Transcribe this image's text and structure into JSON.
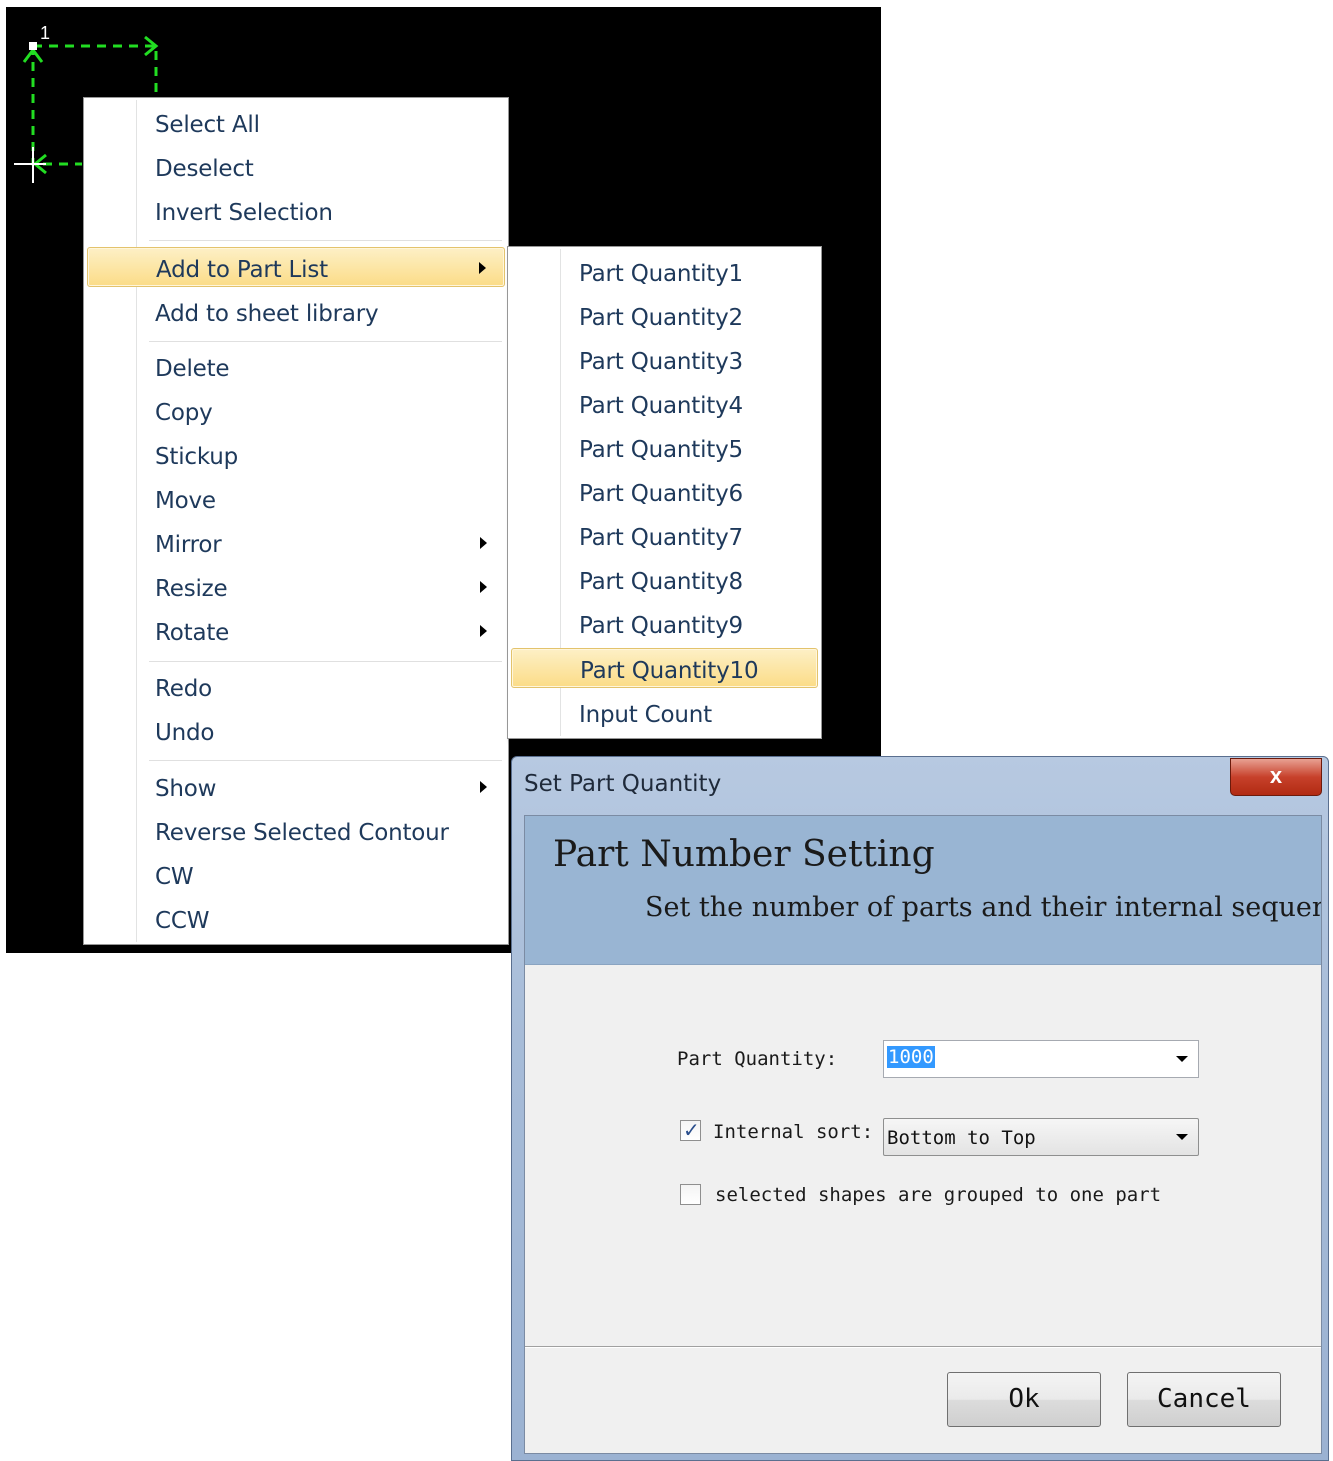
{
  "canvas": {
    "point_label": "1",
    "path_color": "#22dd22"
  },
  "context_menu": {
    "items": [
      {
        "label": "Select All"
      },
      {
        "label": "Deselect"
      },
      {
        "label": "Invert Selection"
      },
      {
        "label": "Add to Part List",
        "submenu": true,
        "highlighted": true
      },
      {
        "label": "Add to sheet library"
      },
      {
        "label": "Delete"
      },
      {
        "label": "Copy"
      },
      {
        "label": "Stickup"
      },
      {
        "label": "Move"
      },
      {
        "label": "Mirror",
        "submenu": true
      },
      {
        "label": "Resize",
        "submenu": true
      },
      {
        "label": "Rotate",
        "submenu": true
      },
      {
        "label": "Redo"
      },
      {
        "label": "Undo"
      },
      {
        "label": "Show",
        "submenu": true
      },
      {
        "label": "Reverse Selected Contour"
      },
      {
        "label": "CW"
      },
      {
        "label": "CCW"
      }
    ]
  },
  "submenu": {
    "items": [
      {
        "label": "Part Quantity1"
      },
      {
        "label": "Part Quantity2"
      },
      {
        "label": "Part Quantity3"
      },
      {
        "label": "Part Quantity4"
      },
      {
        "label": "Part Quantity5"
      },
      {
        "label": "Part Quantity6"
      },
      {
        "label": "Part Quantity7"
      },
      {
        "label": "Part Quantity8"
      },
      {
        "label": "Part Quantity9"
      },
      {
        "label": "Part Quantity10",
        "highlighted": true
      },
      {
        "label": "Input Count"
      }
    ]
  },
  "dialog": {
    "title": "Set Part Quantity",
    "close_label": "x",
    "header_title": "Part Number Setting",
    "header_subtitle": "Set the number of parts and their internal sequence",
    "quantity_label": "Part Quantity:",
    "quantity_value": "1000",
    "internal_sort_label": "Internal sort:",
    "internal_sort_checked": true,
    "internal_sort_value": "Bottom to Top",
    "grouped_label": "selected shapes are grouped to one part",
    "grouped_checked": false,
    "ok_label": "Ok",
    "cancel_label": "Cancel"
  },
  "colors": {
    "menu_text": "#1e395b",
    "highlight": "#fbdc87",
    "dialog_header": "#99b5d3",
    "close_button": "#c7412b"
  }
}
